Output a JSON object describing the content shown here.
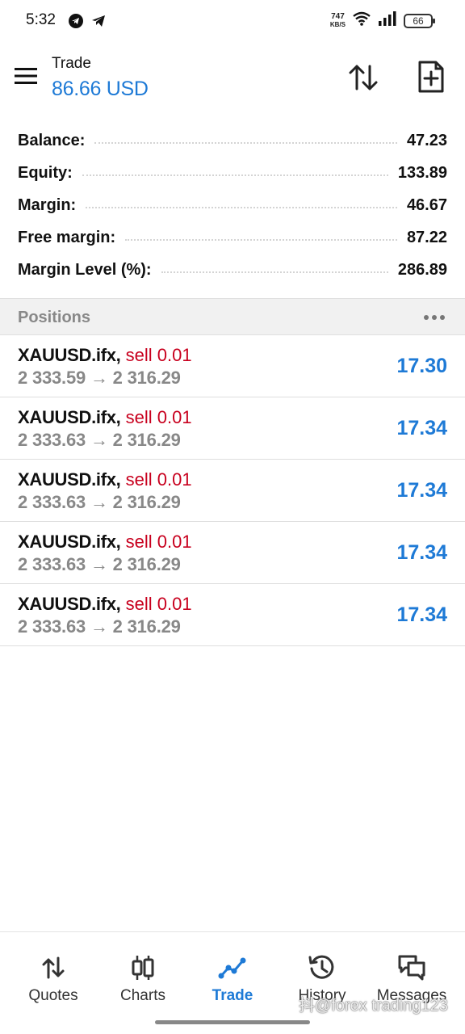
{
  "status_bar": {
    "time": "5:32",
    "left_icons": [
      "telegram-icon",
      "send-icon"
    ],
    "net_speed_value": "747",
    "net_speed_unit": "KB/S",
    "battery": "66"
  },
  "header": {
    "title": "Trade",
    "balance": "86.66 USD",
    "icons": [
      "menu-icon",
      "sort-icon",
      "new-order-icon"
    ]
  },
  "summary": {
    "rows": [
      {
        "label": "Balance:",
        "value": "47.23"
      },
      {
        "label": "Equity:",
        "value": "133.89"
      },
      {
        "label": "Margin:",
        "value": "46.67"
      },
      {
        "label": "Free margin:",
        "value": "87.22"
      },
      {
        "label": "Margin Level (%):",
        "value": "286.89"
      }
    ]
  },
  "positions": {
    "title": "Positions",
    "items": [
      {
        "symbol": "XAUUSD.ifx,",
        "type": "sell 0.01",
        "prices": "2 333.59 → 2 316.29",
        "profit": "17.30"
      },
      {
        "symbol": "XAUUSD.ifx,",
        "type": "sell 0.01",
        "prices": "2 333.63 → 2 316.29",
        "profit": "17.34"
      },
      {
        "symbol": "XAUUSD.ifx,",
        "type": "sell 0.01",
        "prices": "2 333.63 → 2 316.29",
        "profit": "17.34"
      },
      {
        "symbol": "XAUUSD.ifx,",
        "type": "sell 0.01",
        "prices": "2 333.63 → 2 316.29",
        "profit": "17.34"
      },
      {
        "symbol": "XAUUSD.ifx,",
        "type": "sell 0.01",
        "prices": "2 333.63 → 2 316.29",
        "profit": "17.34"
      }
    ]
  },
  "bottom_nav": {
    "items": [
      {
        "label": "Quotes",
        "icon": "quotes-icon"
      },
      {
        "label": "Charts",
        "icon": "charts-icon"
      },
      {
        "label": "Trade",
        "icon": "trade-icon",
        "active": true
      },
      {
        "label": "History",
        "icon": "history-icon"
      },
      {
        "label": "Messages",
        "icon": "messages-icon"
      }
    ]
  },
  "watermark": "抖@forex trading123",
  "colors": {
    "accent": "#1e7ad6",
    "sell": "#c8001e",
    "muted": "#888888"
  }
}
